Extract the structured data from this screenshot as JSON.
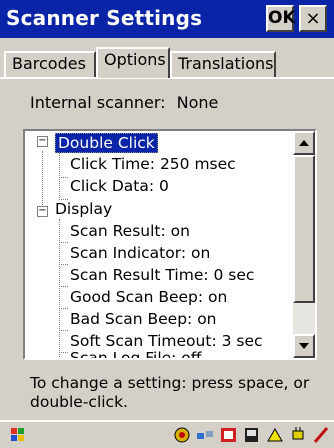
{
  "window": {
    "title": "Scanner Settings",
    "ok_label": "OK",
    "close_label": "×"
  },
  "tabs": [
    {
      "label": "Barcodes"
    },
    {
      "label": "Options"
    },
    {
      "label": "Translations"
    }
  ],
  "active_tab": "Options",
  "internal_scanner": {
    "label": "Internal scanner:",
    "value": "None"
  },
  "tree": {
    "items": [
      {
        "text": "Double Click"
      },
      {
        "text": "Click Time: 250 msec"
      },
      {
        "text": "Click Data: 0"
      },
      {
        "text": "Display"
      },
      {
        "text": "Scan Result: on"
      },
      {
        "text": "Scan Indicator: on"
      },
      {
        "text": "Scan Result Time: 0 sec"
      },
      {
        "text": "Good Scan Beep: on"
      },
      {
        "text": "Bad Scan Beep: on"
      },
      {
        "text": "Soft Scan Timeout: 3 sec"
      },
      {
        "text": "Scan Log File: off"
      }
    ]
  },
  "help_text": "To change a setting: press space, or double-click.",
  "colors": {
    "titlebar": "#0a24a8",
    "selection": "#0a24a8",
    "chrome": "#d4d0c8"
  },
  "taskbar": {
    "icons": [
      "start-flag-icon",
      "network-icon",
      "connection-icon",
      "stop-icon",
      "card-icon",
      "battery-icon",
      "power-plug-icon",
      "pen-icon"
    ]
  }
}
